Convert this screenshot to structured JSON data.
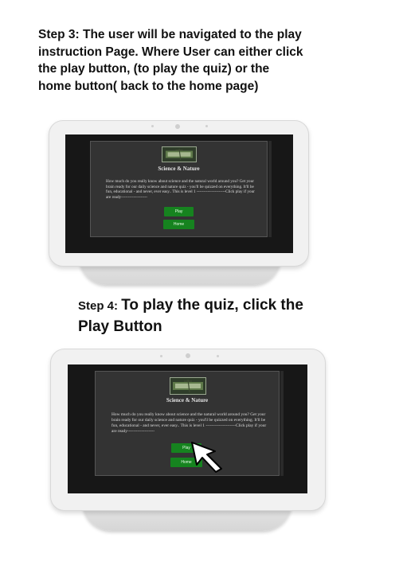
{
  "step3": {
    "lines": [
      "Step 3: The user will be navigated to the play",
      "instruction Page. Where User can either click",
      "the play button, (to play the quiz)  or the",
      "home button( back to the home  page)"
    ]
  },
  "step4": {
    "prefix": "Step 4: ",
    "line1_rest": "To play the quiz, click the",
    "line2": "Play Button"
  },
  "app": {
    "title": "Science & Nature",
    "description": "How much do you really know about science and the natural world around you? Get your brain ready for our daily science and nature quiz - you'll be quizzed on everything. It'll be fun, educational - and never, ever easy.. This is level 1 ---------------------Click play if your are ready-------------------",
    "play_label": "Play",
    "home_label": "Home"
  },
  "colors": {
    "button_green": "#16831f",
    "panel_gray": "#333333",
    "screen_dark": "#171717"
  }
}
